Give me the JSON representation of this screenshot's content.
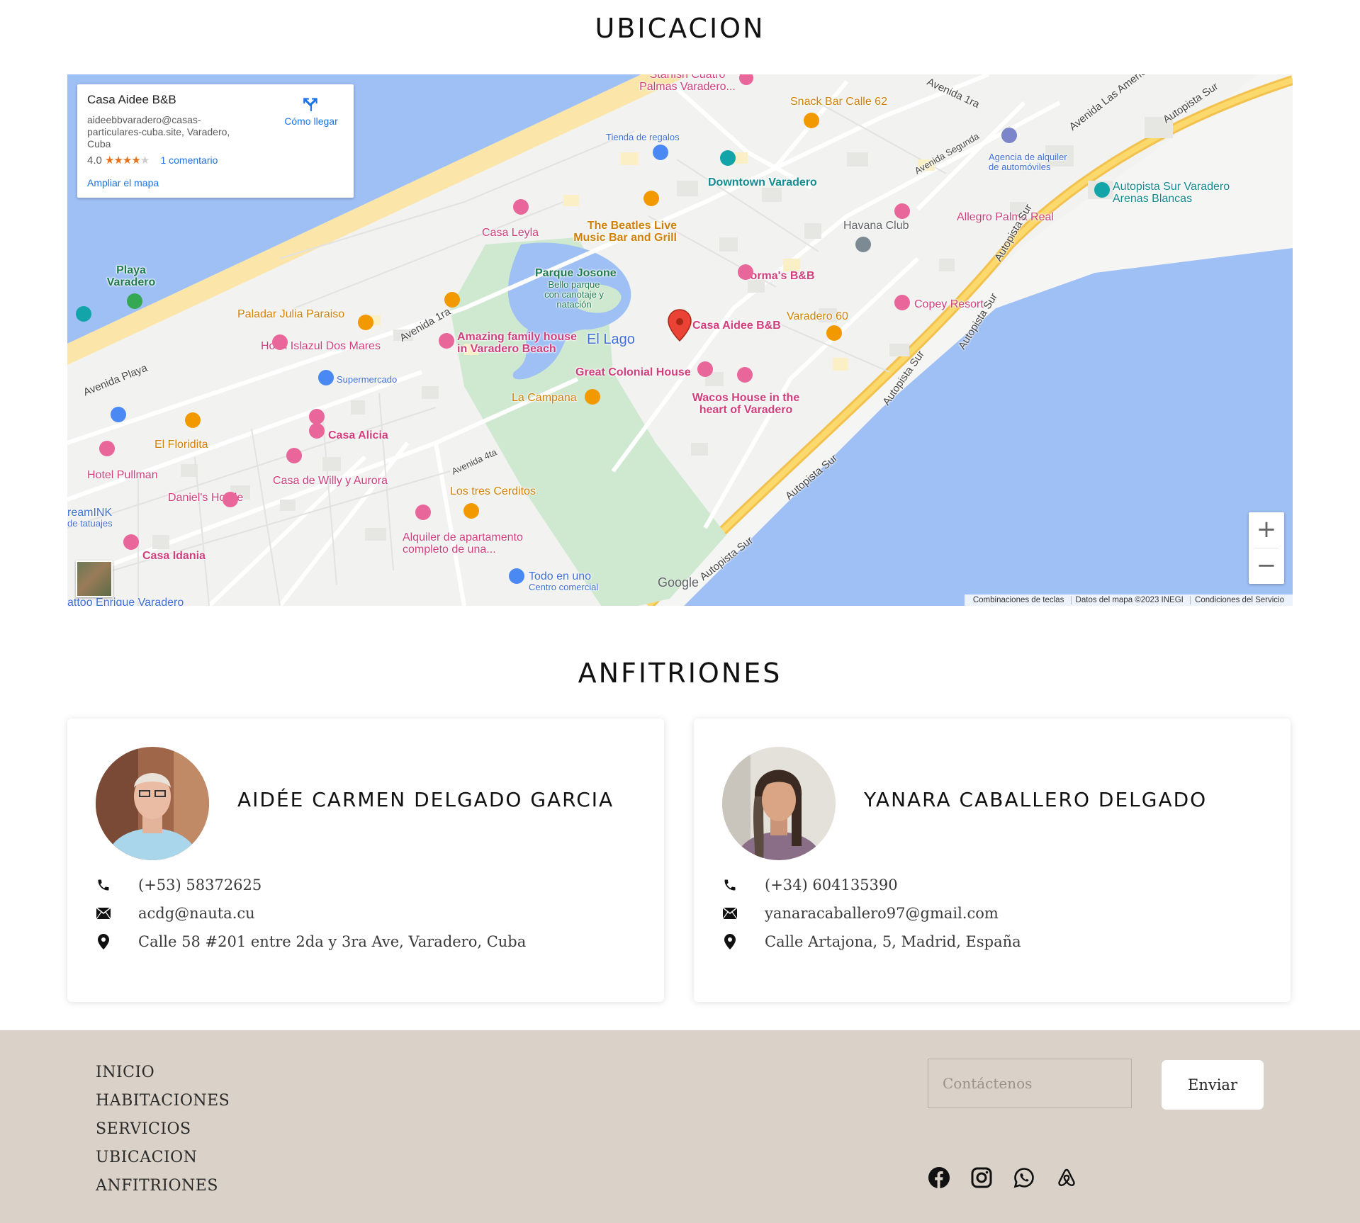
{
  "sections": {
    "location_title": "UBICACION",
    "hosts_title": "ANFITRIONES"
  },
  "map": {
    "info_card": {
      "name": "Casa Aidee B&B",
      "address": "aideebbvaradero@casas-particulares-cuba.site, Varadero, Cuba",
      "rating": "4.0",
      "reviews": "1 comentario",
      "directions": "Cómo llegar",
      "enlarge": "Ampliar el mapa"
    },
    "labels": {
      "starfish": "Starfish Cuatro Palmas Varadero...",
      "snack_bar": "Snack Bar Calle 62",
      "avenida_1ra_top": "Avenida 1ra",
      "av_americas": "Avenida Las Americas",
      "autopista_sur_1": "Autopista Sur",
      "tienda": "Tienda de regalos",
      "downtown": "Downtown Varadero",
      "av_segunda": "Avenida Segunda",
      "agencia": "Agencia de alquiler de automóviles",
      "autopista_arenas": "Autopista Sur Varadero Arenas Blancas",
      "casa_leyla": "Casa Leyla",
      "beatles": "The Beatles Live Music Bar and Grill",
      "havana_club": "Havana Club",
      "allegro": "Allegro Palma Real",
      "playa_varadero": "Playa Varadero",
      "parque_josone": "Parque Josone",
      "parque_desc": "Bello parque con canotaje y natación",
      "normas": "Norma's B&B",
      "copey": "Copey Resort",
      "paladar": "Paladar Julia Paraiso",
      "avenida_1ra": "Avenida 1ra",
      "casa_aidee": "Casa Aidee B&B",
      "varadero60": "Varadero 60",
      "hotel_islazul": "Hotel Islazul Dos Mares",
      "amazing": "Amazing family house in Varadero Beach",
      "el_lago": "El Lago",
      "avenida_playa": "Avenida Playa",
      "supermercado": "Supermercado",
      "great_colonial": "Great Colonial House",
      "la_campana": "La Campana",
      "wacos": "Wacos House in the heart of Varadero",
      "casa_alicia": "Casa Alicia",
      "el_floridita": "El Floridita",
      "hotel_pullman": "Hotel Pullman",
      "casa_willy": "Casa de Willy y Aurora",
      "avenida_4ta": "Avenida 4ta",
      "daniels": "Daniel's Hostle",
      "los_tres": "Los tres Cerditos",
      "reamink": "reamINK",
      "tatuajes": "de tatuajes",
      "alquiler": "Alquiler de apartamento completo de una...",
      "casa_idania": "Casa Idania",
      "todo_en_uno": "Todo en uno",
      "centro_comercial": "Centro comercial",
      "enrique": "attoo Enrique Varadero",
      "autopista_sur_2": "Autopista Sur",
      "autopista_sur_3": "Autopista Sur",
      "autopista_sur_4": "Autopista Sur",
      "autopista_sur_5": "Autopista Sur",
      "autopista_sur_6": "Autopista Sur"
    },
    "google_logo": "Google",
    "zoom_in": "+",
    "zoom_out": "−",
    "attribution": {
      "shortcuts": "Combinaciones de teclas",
      "data": "Datos del mapa ©2023 INEGI",
      "terms": "Condiciones del Servicio"
    }
  },
  "hosts": [
    {
      "name": "AIDÉE CARMEN DELGADO GARCIA",
      "phone": "(+53) 58372625",
      "email": "acdg@nauta.cu",
      "address": "Calle 58 #201 entre 2da y 3ra Ave, Varadero, Cuba"
    },
    {
      "name": "YANARA CABALLERO DELGADO",
      "phone": "(+34) 604135390",
      "email": "yanaracaballero97@gmail.com",
      "address": "Calle Artajona, 5, Madrid, España"
    }
  ],
  "footer": {
    "nav": [
      "INICIO",
      "HABITACIONES",
      "SERVICIOS",
      "UBICACION",
      "ANFITRIONES"
    ],
    "contact_placeholder": "Contáctenos",
    "send_label": "Enviar",
    "social": [
      "facebook-icon",
      "instagram-icon",
      "whatsapp-icon",
      "airbnb-icon"
    ]
  },
  "colors": {
    "water": "#9fc0f5",
    "beach": "#fbe5a8",
    "park": "#cfe8d0",
    "highway": "#f7c957",
    "footer_bg": "#dad2c8"
  }
}
